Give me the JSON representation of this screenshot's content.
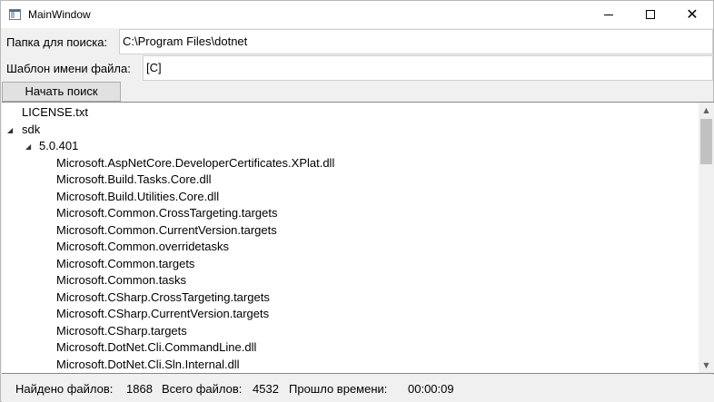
{
  "window": {
    "title": "MainWindow",
    "icon": "app-window-icon",
    "close_glyph": "✕"
  },
  "form": {
    "folder_label": "Папка для поиска:",
    "folder_value": "C:\\Program Files\\dotnet",
    "pattern_label": "Шаблон имени файла:",
    "pattern_value": "[C]",
    "search_button": "Начать поиск"
  },
  "tree": {
    "expander_glyph": "◢",
    "root_file": "LICENSE.txt",
    "sdk_folder": "sdk",
    "version_folder": "5.0.401",
    "files": [
      "Microsoft.AspNetCore.DeveloperCertificates.XPlat.dll",
      "Microsoft.Build.Tasks.Core.dll",
      "Microsoft.Build.Utilities.Core.dll",
      "Microsoft.Common.CrossTargeting.targets",
      "Microsoft.Common.CurrentVersion.targets",
      "Microsoft.Common.overridetasks",
      "Microsoft.Common.targets",
      "Microsoft.Common.tasks",
      "Microsoft.CSharp.CrossTargeting.targets",
      "Microsoft.CSharp.CurrentVersion.targets",
      "Microsoft.CSharp.targets",
      "Microsoft.DotNet.Cli.CommandLine.dll",
      "Microsoft.DotNet.Cli.Sln.Internal.dll"
    ]
  },
  "scrollbar": {
    "up_glyph": "▲",
    "down_glyph": "▼"
  },
  "status": {
    "found_label": "Найдено файлов:",
    "found_value": "1868",
    "total_label": "Всего файлов:",
    "total_value": "4532",
    "elapsed_label": "Прошло времени:",
    "elapsed_value": "00:00:09"
  }
}
